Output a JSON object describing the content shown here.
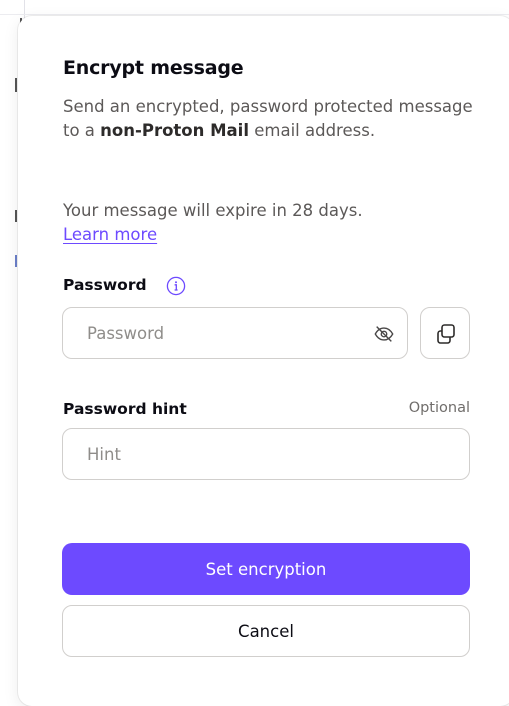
{
  "modal": {
    "title": "Encrypt message",
    "description_prefix": "Send an encrypted, password protected message to a ",
    "description_bold": "non-Proton Mail",
    "description_suffix": " email address.",
    "expiry_text": "Your message will expire in 28 days.",
    "learn_more": "Learn more",
    "password": {
      "label": "Password",
      "placeholder": "Password",
      "value": ""
    },
    "hint": {
      "label": "Password hint",
      "optional": "Optional",
      "placeholder": "Hint",
      "value": ""
    },
    "buttons": {
      "primary": "Set encryption",
      "secondary": "Cancel"
    }
  },
  "icons": {
    "info": "info-circle-icon",
    "eye": "eye-slash-icon",
    "copy": "copy-icon"
  },
  "colors": {
    "accent": "#6d4aff",
    "text_primary": "#0c0c14",
    "text_secondary": "#5c5958",
    "border": "#d1cfcd"
  }
}
